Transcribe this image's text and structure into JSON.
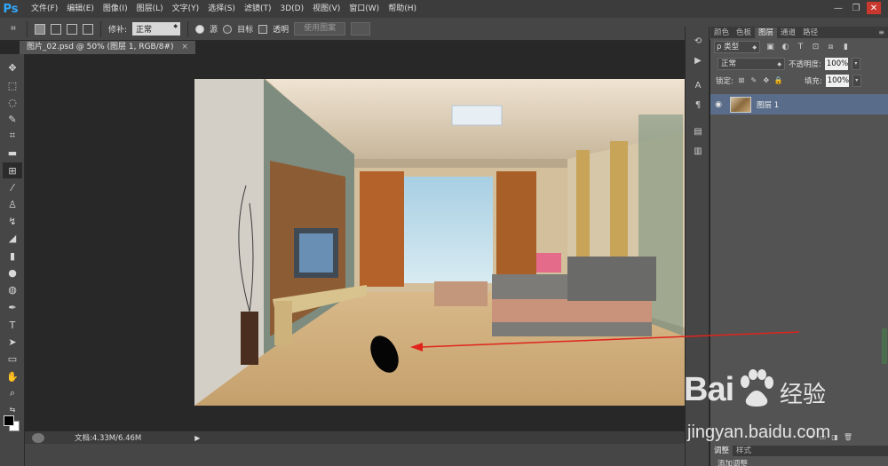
{
  "app": {
    "logo": "Ps"
  },
  "menu": [
    "文件(F)",
    "编辑(E)",
    "图像(I)",
    "图层(L)",
    "文字(Y)",
    "选择(S)",
    "滤镜(T)",
    "3D(D)",
    "视图(V)",
    "窗口(W)",
    "帮助(H)"
  ],
  "window_controls": {
    "minimize": "—",
    "restore": "❐",
    "close": "✕"
  },
  "options_bar": {
    "mode_label": "修补:",
    "mode_value": "正常",
    "source_label": "源",
    "target_label": "目标",
    "transparent_label": "透明",
    "use_pattern_label": "使用图案"
  },
  "document": {
    "tab_title": "图片_02.psd @ 50% (图层 1, RGB/8#)",
    "close": "×"
  },
  "status": {
    "doc_info": "文档:4.33M/6.46M",
    "arrow": "▶"
  },
  "panels": {
    "top_tabs": [
      "颜色",
      "色板",
      "图层",
      "通道",
      "路径"
    ],
    "active_tab": "图层",
    "menu_icon": "≡",
    "filter_label": "ρ 类型",
    "blend_mode": "正常",
    "opacity_label": "不透明度:",
    "opacity_value": "100%",
    "lock_label": "锁定:",
    "fill_label": "填充:",
    "fill_value": "100%",
    "layers": [
      {
        "name": "图层 1",
        "visible": true,
        "selected": true
      }
    ],
    "bottom_tabs": [
      "调整",
      "样式"
    ],
    "adjust_label": "添加调整"
  },
  "watermark": {
    "brand_a": "Bai",
    "brand_b": "经验",
    "url": "jingyan.baidu.com"
  },
  "colors": {
    "accent": "#31a8ff",
    "selected_layer": "#596c89",
    "annotation_arrow": "#e0241c"
  },
  "icons": {
    "tools": [
      "move-icon",
      "marquee-icon",
      "lasso-icon",
      "quick-select-icon",
      "crop-icon",
      "eyedropper-icon",
      "patch-icon",
      "brush-icon",
      "stamp-icon",
      "history-brush-icon",
      "eraser-icon",
      "gradient-icon",
      "blur-icon",
      "dodge-icon",
      "pen-icon",
      "type-icon",
      "path-select-icon",
      "shape-icon",
      "hand-icon",
      "zoom-icon"
    ]
  }
}
